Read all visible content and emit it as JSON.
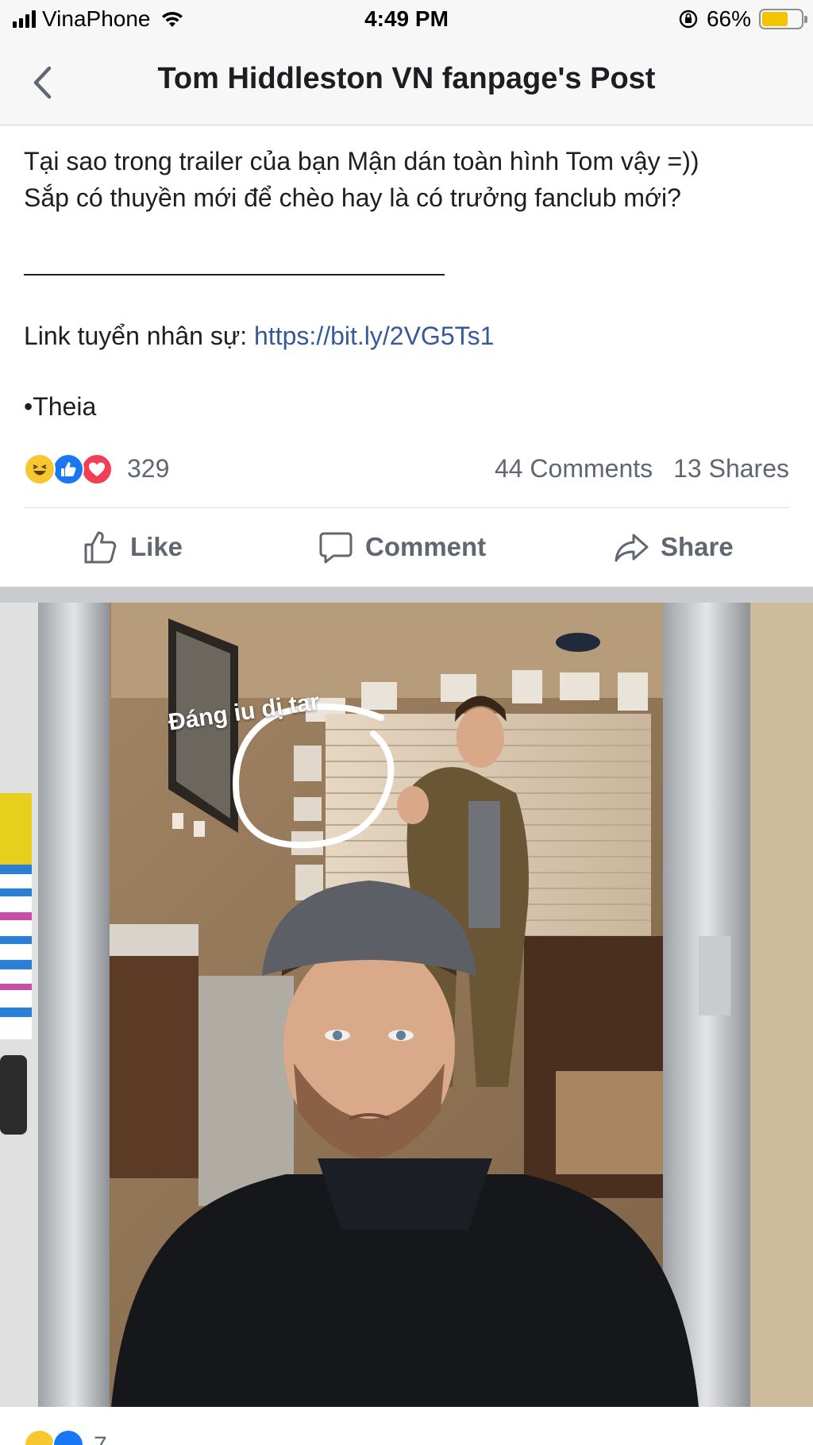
{
  "status_bar": {
    "carrier": "VinaPhone",
    "time": "4:49 PM",
    "battery_percent": "66%",
    "battery_level": 0.66,
    "battery_color": "#f5c400"
  },
  "nav": {
    "back_icon": "chevron-left-icon",
    "title": "Tom Hiddleston VN fanpage's Post"
  },
  "post": {
    "line1": "Tại sao trong trailer của bạn Mận dán toàn hình Tom vậy =))",
    "line2": "Sắp có thuyền mới để chèo hay là có trưởng fanclub mới?",
    "link_label": "Link tuyển nhân sự: ",
    "link_url": "https://bit.ly/2VG5Ts1",
    "signature": "•Theia",
    "link_color": "#385898"
  },
  "reactions": {
    "icons": [
      "haha-icon",
      "like-icon",
      "love-icon"
    ],
    "count": "329",
    "comments": "44 Comments",
    "shares": "13 Shares"
  },
  "actions": {
    "like": "Like",
    "comment": "Comment",
    "share": "Share"
  },
  "photo": {
    "caption": "Đáng iu dị tar"
  },
  "next_reactions": {
    "count": "7"
  }
}
